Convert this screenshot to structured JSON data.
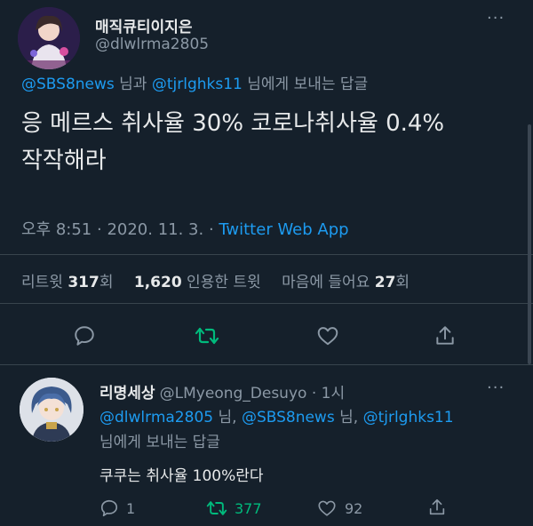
{
  "main_tweet": {
    "display_name": "매직큐티이지은",
    "handle": "@dlwlrma2805",
    "more": "···",
    "reply_to": {
      "user1": "@SBS8news",
      "connector": " 님과 ",
      "user2": "@tjrlghks11",
      "suffix": " 님에게 보내는 답글"
    },
    "text_line1": "응 메르스 취사율 30% 코로나취사율 0.4%",
    "text_line2": "작작해라",
    "time": "오후 8:51",
    "sep1": " · ",
    "date": "2020. 11. 3.",
    "sep2": " · ",
    "source": "Twitter Web App",
    "stats": {
      "retweet_label": "리트윗 ",
      "retweet_count": "317",
      "retweet_unit": "회",
      "quote_count": "1,620",
      "quote_label": " 인용한 트윗",
      "like_label": "마음에 들어요 ",
      "like_count": "27",
      "like_unit": "회"
    }
  },
  "reply_tweet": {
    "display_name": "리명세상",
    "handle": "@LMyeong_Desuyo",
    "sep": " · ",
    "time": "1시",
    "more": "···",
    "reply_to": {
      "user1": "@dlwlrma2805",
      "s1": " 님, ",
      "user2": "@SBS8news",
      "s2": " 님, ",
      "user3": "@tjrlghks11",
      "line2": "님에게 보내는 답글"
    },
    "text": "쿠쿠는 취사율 100%란다",
    "actions": {
      "reply_count": "1",
      "retweet_count": "377",
      "like_count": "92"
    }
  },
  "colors": {
    "background": "#15202b",
    "link": "#1d9bf0",
    "retweet": "#00ba7c",
    "muted": "#8b98a5",
    "text": "#e7e9ea",
    "divider": "#38444d"
  },
  "icons": [
    "reply-icon",
    "retweet-icon",
    "like-icon",
    "share-icon",
    "more-icon"
  ]
}
